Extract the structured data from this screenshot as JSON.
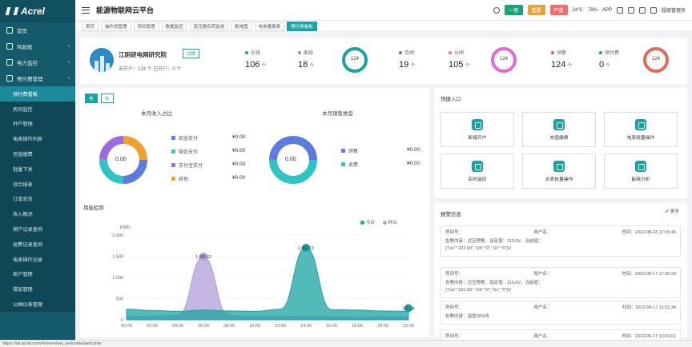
{
  "sidebar": {
    "logo": "Acrel",
    "groups": [
      {
        "label": "首页",
        "icon": "home-icon"
      },
      {
        "label": "驾驶舱",
        "icon": "dashboard-icon"
      },
      {
        "label": "电力监控",
        "icon": "power-icon"
      },
      {
        "label": "预付费管理",
        "icon": "prepay-icon"
      }
    ],
    "sub_items": [
      "预付费看板",
      "房间监控",
      "开户管理",
      "电表操作列表",
      "充值缴费",
      "批量下发",
      "综合报表",
      "订单总览",
      "收入概况",
      "销户记录查询",
      "退费记录查询",
      "电表操作记录",
      "商户管理",
      "楼层管理",
      "公摊仪表管理"
    ]
  },
  "topbar": {
    "title": "能源物联网云平台",
    "badge1": "一般",
    "badge1_count": "0",
    "badge2": "重要",
    "badge2_count": "0",
    "badge3": "严重",
    "badge3_count": "0",
    "weather": "24℃",
    "humidity": "79%",
    "app": "APP",
    "user": "超级管理员",
    "colors": {
      "badge1": "#1aa37a",
      "badge2": "#e6a23c",
      "badge3": "#f56c6c"
    }
  },
  "tabs": [
    "首页",
    "操作员管理",
    "项目管理",
    "数据监控",
    "变压器负荷监测",
    "配电图",
    "电参量报表",
    "预付费看板"
  ],
  "org": {
    "name": "江阴研电网研究院",
    "button": "切换",
    "stats_text": "未开户：124 个    已开户：0 个"
  },
  "summary": [
    {
      "label": "在线",
      "value": "106",
      "unit": "个",
      "color": "#1aa3a3"
    },
    {
      "label": "离线",
      "value": "18",
      "unit": "个",
      "color": "#999999"
    },
    {
      "label": "合闸",
      "value": "19",
      "unit": "个",
      "color": "#5b7be0"
    },
    {
      "label": "分闸",
      "value": "105",
      "unit": "个",
      "color": "#e06bd6"
    },
    {
      "label": "预警",
      "value": "124",
      "unit": "个",
      "color": "#e05b5b"
    },
    {
      "label": "预付费",
      "value": "0",
      "unit": "个",
      "color": "#1aa3a3"
    }
  ],
  "rings": [
    {
      "value": "124",
      "color": "#1aa3a3"
    },
    {
      "value": "124",
      "color": "#e06bd6"
    },
    {
      "value": "124",
      "color": "#e06b5b"
    }
  ],
  "toggle": {
    "left": "电",
    "right": "水"
  },
  "income": {
    "title": "本月收入占比",
    "center": "0.00",
    "items": [
      {
        "label": "现金支付",
        "value": "¥0.00",
        "color": "#5b7be0"
      },
      {
        "label": "微信支付",
        "value": "¥0.00",
        "color": "#2ec4c4"
      },
      {
        "label": "支付宝支付",
        "value": "¥0.00",
        "color": "#9b6be0"
      },
      {
        "label": "其他",
        "value": "¥0.00",
        "color": "#f0a030"
      }
    ]
  },
  "sales": {
    "title": "本月销售类型",
    "center": "0.00",
    "items": [
      {
        "label": "销售",
        "value": "¥0.00",
        "color": "#5b7be0"
      },
      {
        "label": "退费",
        "value": "¥0.00",
        "color": "#2ec4c4"
      }
    ]
  },
  "trend": {
    "title": "用能趋势",
    "unit": "kWh",
    "legend": [
      {
        "label": "今日",
        "color": "#1aa3a3"
      },
      {
        "label": "昨日",
        "color": "#b39ddb"
      }
    ]
  },
  "chart_data": {
    "type": "area",
    "ylabel": "kWh",
    "ylim": [
      0,
      2000
    ],
    "yticks": [
      "0",
      "500",
      "1,000",
      "1,500",
      "2,000"
    ],
    "x": [
      "00:00",
      "02:00",
      "04:00",
      "06:00",
      "08:00",
      "10:00",
      "12:00",
      "14:00",
      "16:00",
      "18:00",
      "20:00",
      "22:00"
    ],
    "series": [
      {
        "name": "今日",
        "color": "#1aa3a3",
        "values": [
          250,
          220,
          200,
          230,
          210,
          200,
          250,
          1700,
          240,
          230,
          210,
          200
        ],
        "peak_label": "1,692.13",
        "end_label": "231.34"
      },
      {
        "name": "昨日",
        "color": "#b39ddb",
        "values": [
          80,
          90,
          100,
          1490,
          100,
          80,
          90,
          80,
          70,
          60,
          70,
          60
        ],
        "peak_label": "1,491.52"
      }
    ]
  },
  "quick": {
    "title": "快捷入口",
    "items": [
      "新增开户",
      "充值缴费",
      "电表批量操作",
      "实时监控",
      "水表批量操作",
      "能耗分析"
    ]
  },
  "alarms": {
    "title": "报警信息",
    "more": "更多",
    "items": [
      {
        "room": "房间号：",
        "user": "用户名：",
        "time": "时间：2022-08-23 17:15:45",
        "desc": "告警内容：过压预警，设定值：110.0V，当前值：",
        "detail": "{\"Ua\":\"222.60\",\"Ub\":\"0\",\"Uc\":\"0\"}V"
      },
      {
        "room": "房间号：",
        "user": "用户名：",
        "time": "时间：2022-08-17 17:36:23",
        "desc": "告警内容：过压预警，设定值：110.0V，当前值：",
        "detail": "{\"Ua\":\"221.60\",\"Ub\":\"0\",\"Uc\":\"0\"}V"
      },
      {
        "room": "房间号：",
        "user": "用户名：",
        "time": "时间：2022-06-17 11:31:34",
        "desc": "告警内容：温度28%传",
        "detail": ""
      },
      {
        "room": "房间号：",
        "user": "用户名：",
        "time": "时间：2022-06-17 10:03:01",
        "desc": "",
        "detail": ""
      }
    ]
  },
  "status_url": "https://iot.acrel.com/#/overview_welcome/welcome"
}
